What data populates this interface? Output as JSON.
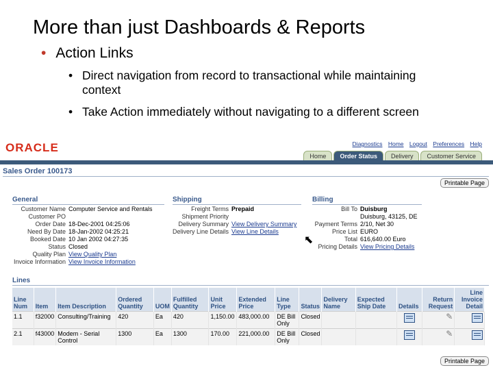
{
  "slide": {
    "title": "More than just Dashboards & Reports",
    "bullet1": "Action Links",
    "sub_bullets": [
      "Direct navigation from record to transactional while maintaining context",
      "Take Action immediately without navigating to a different screen"
    ]
  },
  "app": {
    "logo": "ORACLE",
    "top_links": [
      "Diagnostics",
      "Home",
      "Logout",
      "Preferences",
      "Help"
    ],
    "tabs": [
      "Home",
      "Order Status",
      "Delivery",
      "Customer Service"
    ],
    "active_tab": "Order Status",
    "order_title": "Sales Order 100173",
    "printable_label": "Printable Page",
    "general": {
      "heading": "General",
      "rows": [
        {
          "k": "Customer Name",
          "v": "Computer Service and Rentals",
          "link": false
        },
        {
          "k": "Customer PO",
          "v": "",
          "link": false
        },
        {
          "k": "Order Date",
          "v": "18-Dec-2001 04:25:06",
          "link": false
        },
        {
          "k": "Need By Date",
          "v": "18-Jan-2002 04:25:21",
          "link": false
        },
        {
          "k": "Booked Date",
          "v": "10 Jan 2002 04:27:35",
          "link": false
        },
        {
          "k": "Status",
          "v": "Closed",
          "link": false
        },
        {
          "k": "Quality Plan",
          "v": "View Quality Plan",
          "link": true
        },
        {
          "k": "Invoice Information",
          "v": "View Invoice Information",
          "link": true
        }
      ]
    },
    "shipping": {
      "heading": "Shipping",
      "rows": [
        {
          "k": "Freight Terms",
          "v": "Prepaid",
          "link": false
        },
        {
          "k": "Shipment Priority",
          "v": "",
          "link": false
        },
        {
          "k": "Delivery Summary",
          "v": "View Delivery Summary",
          "link": true
        },
        {
          "k": "Delivery Line Details",
          "v": "View Line Details",
          "link": true
        }
      ]
    },
    "billing": {
      "heading": "Billing",
      "rows": [
        {
          "k": "Bill To",
          "v": "Duisburg",
          "link": false
        },
        {
          "k": "",
          "v": "Duisburg, 43125, DE",
          "link": false
        },
        {
          "k": "Payment Terms",
          "v": "2/10, Net 30",
          "link": false
        },
        {
          "k": "Price List",
          "v": "EURO",
          "link": false
        },
        {
          "k": "Total",
          "v": "616,640.00 Euro",
          "link": false
        },
        {
          "k": "Pricing Details",
          "v": "View Pricing Details",
          "link": true
        }
      ]
    },
    "lines": {
      "heading": "Lines",
      "columns": [
        "Line Num",
        "Item",
        "Item Description",
        "Ordered Quantity",
        "UOM",
        "Fulfilled Quantity",
        "Unit Price",
        "Extended Price",
        "Line Type",
        "Status",
        "Delivery Name",
        "Expected Ship Date",
        "Details",
        "Return Request",
        "Line Invoice Detail"
      ],
      "rows": [
        [
          "1.1",
          "f32000",
          "Consulting/Training",
          "420",
          "Ea",
          "420",
          "1,150.00",
          "483,000.00",
          "DE Bill Only",
          "Closed",
          "",
          "",
          "",
          "",
          ""
        ],
        [
          "2.1",
          "f43000",
          "Modem - Serial Control",
          "1300",
          "Ea",
          "1300",
          "170.00",
          "221,000.00",
          "DE Bill Only",
          "Closed",
          "",
          "",
          "",
          "",
          ""
        ]
      ]
    }
  },
  "colors": {
    "accent": "#3c5a7a",
    "logo": "#d62c1a",
    "link": "#1a3a8f"
  }
}
